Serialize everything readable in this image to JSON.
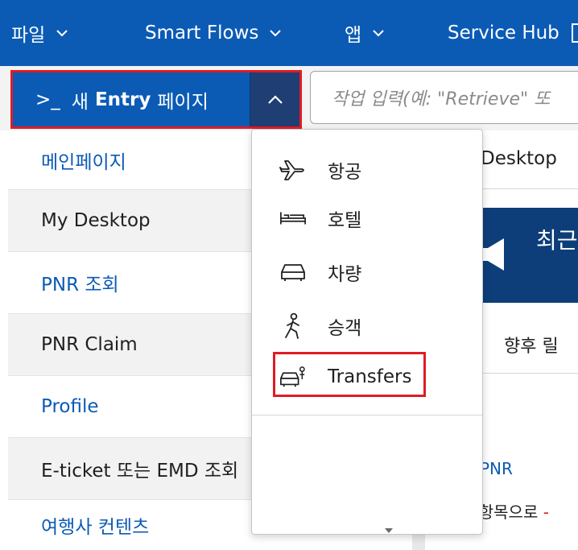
{
  "menubar": {
    "items": [
      {
        "label": "파일"
      },
      {
        "label": "Smart Flows"
      },
      {
        "label": "앱"
      },
      {
        "label": "Service Hub"
      }
    ]
  },
  "entry_button": {
    "prefix": ">_",
    "label_ko_new": "새",
    "label_bold": "Entry",
    "label_ko_page": "페이지"
  },
  "task_input": {
    "placeholder": "작업 입력(예: \"Retrieve\" 또"
  },
  "sidebar": {
    "items": [
      {
        "label": "메인페이지"
      },
      {
        "label": "My Desktop"
      },
      {
        "label": "PNR 조회"
      },
      {
        "label": "PNR Claim"
      },
      {
        "label": "Profile"
      },
      {
        "label": "E-ticket 또는 EMD 조회"
      },
      {
        "label": "여행사 컨텐츠"
      }
    ]
  },
  "dropdown": {
    "items": [
      {
        "label": "항공",
        "icon": "airplane-icon"
      },
      {
        "label": "호텔",
        "icon": "bed-icon"
      },
      {
        "label": "차량",
        "icon": "car-icon"
      },
      {
        "label": "승객",
        "icon": "passenger-icon"
      },
      {
        "label": "Transfers",
        "icon": "transfer-icon"
      }
    ]
  },
  "right_panel": {
    "title": "Desktop",
    "banner_text": "최근",
    "subtitle": "향후 릴",
    "link": "PNR",
    "line2_pre": "음 항목으로",
    "line2_red": "-"
  },
  "colors": {
    "brand_blue": "#0b5bb5",
    "dark_blue": "#1e3e74",
    "highlight_red": "#e01b24"
  }
}
